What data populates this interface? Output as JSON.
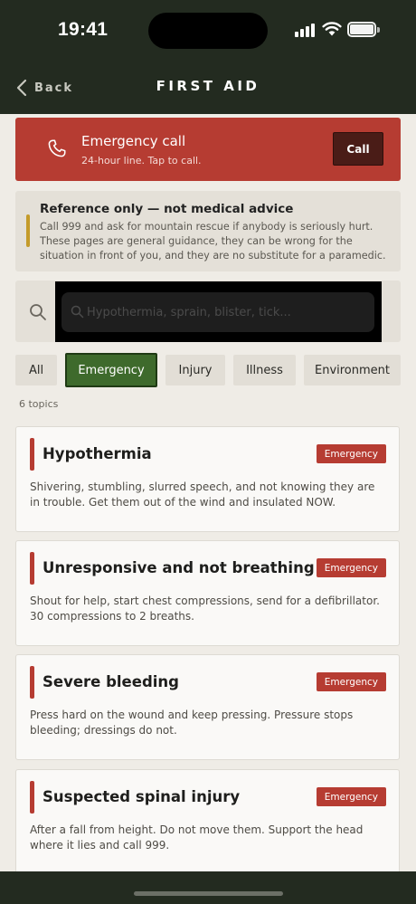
{
  "status_bar": {
    "time": "19:41"
  },
  "nav": {
    "back_label": "Back",
    "title": "FIRST AID"
  },
  "emergency": {
    "title": "Emergency call",
    "subtitle": "24-hour line. Tap to call.",
    "call_label": "Call",
    "accent_color": "#b63c32"
  },
  "disclaimer": {
    "title": "Reference only — not medical advice",
    "body": "Call 999 and ask for mountain rescue if anybody is seriously hurt. These pages are general guidance, they can be wrong for the situation in front of you, and they are no substitute for a paramedic."
  },
  "search": {
    "placeholder": "Hypothermia, sprain, blister, tick...",
    "value": ""
  },
  "filters": [
    {
      "label": "All",
      "active": false
    },
    {
      "label": "Emergency",
      "active": true
    },
    {
      "label": "Injury",
      "active": false
    },
    {
      "label": "Illness",
      "active": false
    },
    {
      "label": "Environment",
      "active": false
    }
  ],
  "topic_count": "6 topics",
  "topics": [
    {
      "title": "Hypothermia",
      "badge": "Emergency",
      "description": "Shivering, stumbling, slurred speech, and not knowing they are in trouble. Get them out of the wind and insulated NOW."
    },
    {
      "title": "Unresponsive and not breathing",
      "badge": "Emergency",
      "description": "Shout for help, start chest compressions, send for a defibrillator. 30 compressions to 2 breaths."
    },
    {
      "title": "Severe bleeding",
      "badge": "Emergency",
      "description": "Press hard on the wound and keep pressing. Pressure stops bleeding; dressings do not."
    },
    {
      "title": "Suspected spinal injury",
      "badge": "Emergency",
      "description": "After a fall from height. Do not move them. Support the head where it lies and call 999."
    }
  ],
  "colors": {
    "header_bg": "#232b20",
    "active_filter": "#3e6a2c",
    "warning_bar": "#c49b2a"
  }
}
